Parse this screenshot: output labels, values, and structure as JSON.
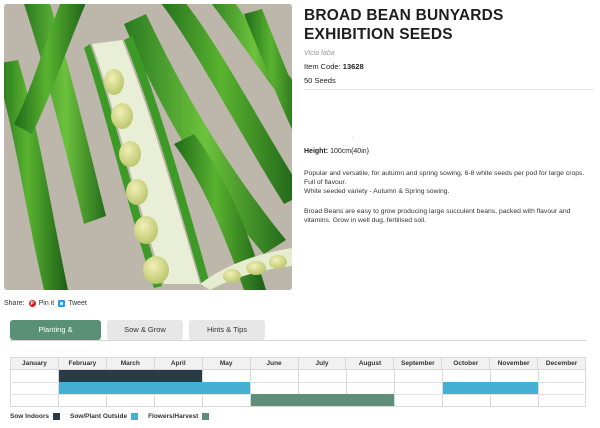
{
  "product": {
    "title": "BROAD BEAN BUNYARDS EXHIBITION SEEDS",
    "latin_name": "Vicia faba",
    "item_code_label": "Item Code:",
    "item_code": "13628",
    "pack_size": "50 Seeds",
    "separator": ".",
    "height_label": "Height:",
    "height_value": "100cm(40in)",
    "description": [
      "Popular and versatile, for autumn and spring sowing, 6-8 white seeds per pod for large crops. Full of flavour.",
      "White seeded variety - Autumn & Spring sowing.",
      "Broad Beans are easy to grow producing large succulent beans, packed with flavour and vitamins. Grow in well dug, fertilised soil."
    ]
  },
  "share": {
    "label": "Share:",
    "pin_label": "Pin it",
    "tweet_label": "Tweet"
  },
  "tabs": [
    {
      "label": "Planting & Harvesting",
      "active": true
    },
    {
      "label": "Sow & Grow",
      "active": false
    },
    {
      "label": "Hints & Tips",
      "active": false
    }
  ],
  "calendar": {
    "months": [
      "January",
      "February",
      "March",
      "April",
      "May",
      "June",
      "July",
      "August",
      "September",
      "October",
      "November",
      "December"
    ],
    "rows": [
      {
        "name": "Sow Indoors",
        "color": "#2a3a47",
        "spans": [
          [
            2,
            4
          ]
        ]
      },
      {
        "name": "Sow/Plant Outside",
        "color": "#45b0d3",
        "spans": [
          [
            2,
            5
          ],
          [
            10,
            11
          ]
        ]
      },
      {
        "name": "Flowers/Harvest",
        "color": "#5f8f7b",
        "spans": [
          [
            6,
            8
          ]
        ]
      }
    ]
  },
  "legend": [
    {
      "label": "Sow Indoors",
      "color": "#2a3a47"
    },
    {
      "label": "Sow/Plant Outside",
      "color": "#45b0d3"
    },
    {
      "label": "Flowers/Harvest",
      "color": "#5f8f7b"
    }
  ],
  "icons": {
    "pinterest": "pinterest-icon",
    "twitter": "twitter-icon"
  },
  "colors": {
    "active_tab": "#5a9176",
    "inactive_tab": "#e7e7e7"
  }
}
